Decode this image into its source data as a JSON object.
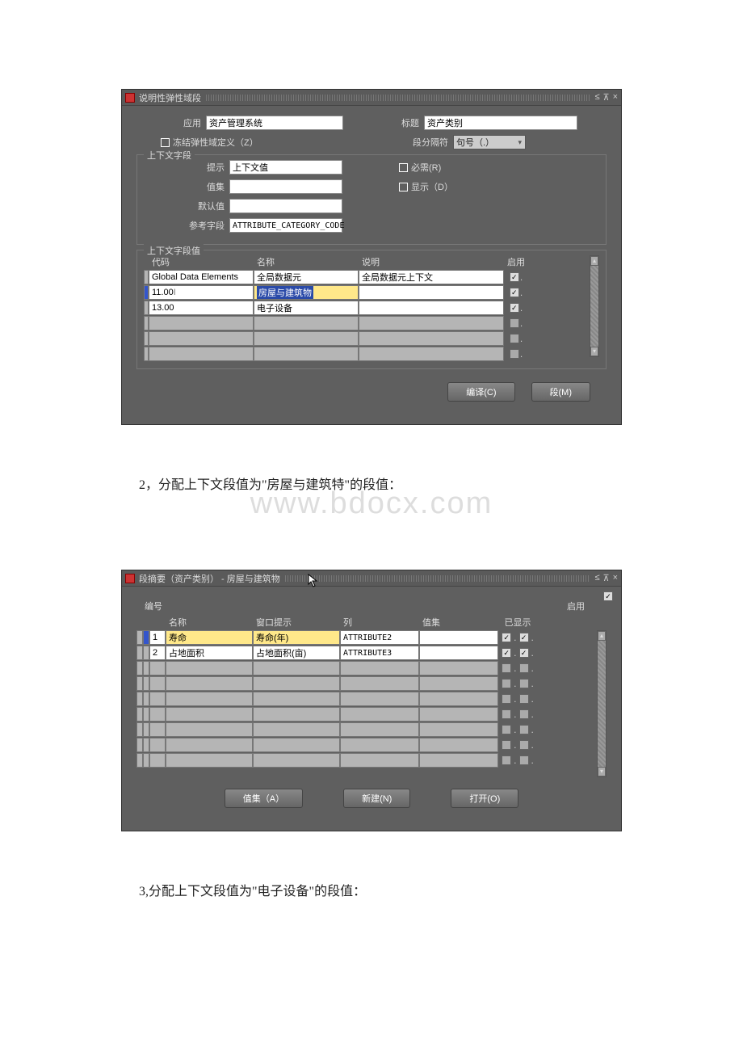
{
  "window1": {
    "title": "说明性弹性域段",
    "labels": {
      "application": "应用",
      "application_value": "资产管理系统",
      "freeze": "冻结弹性域定义（Z）",
      "title_lbl": "标题",
      "title_value": "资产类别",
      "separator": "段分隔符",
      "separator_value": "句号（.）",
      "context_fieldset": "上下文字段",
      "prompt": "提示",
      "prompt_value": "上下文值",
      "valueset": "值集",
      "valueset_value": "",
      "default": "默认值",
      "default_value": "",
      "reference": "参考字段",
      "reference_value": "ATTRIBUTE_CATEGORY_CODE",
      "required": "必需(R)",
      "display": "显示（D）",
      "context_values_fieldset": "上下文字段值",
      "cols": {
        "code": "代码",
        "name": "名称",
        "desc": "说明",
        "enabled": "启用"
      }
    },
    "rows": [
      {
        "code": "Global Data Elements",
        "name": "全局数据元",
        "desc": "全局数据元上下文",
        "enabled": true,
        "active": false,
        "hl": false
      },
      {
        "code": "11.00",
        "name": "房屋与建筑物",
        "desc": "",
        "enabled": true,
        "active": true,
        "hl": true
      },
      {
        "code": "13.00",
        "name": "电子设备",
        "desc": "",
        "enabled": true,
        "active": false,
        "hl": false
      }
    ],
    "buttons": {
      "compile": "编译(C)",
      "segment": "段(M)"
    }
  },
  "text1": "2，分配上下文段值为\"房屋与建筑特\"的段值：",
  "watermark": "www.bdocx.com",
  "window2": {
    "title": "段摘要（资产类别） - 房屋与建筑物",
    "labels": {
      "number": "编号",
      "enabled": "启用",
      "name": "名称",
      "winprompt": "窗口提示",
      "col": "列",
      "valueset": "值集",
      "displayed": "已显示"
    },
    "rows": [
      {
        "num": "1",
        "name": "寿命",
        "prompt": "寿命(年)",
        "col": "ATTRIBUTE2",
        "vs": "",
        "e1": true,
        "e2": true,
        "active": true
      },
      {
        "num": "2",
        "name": "占地面积",
        "prompt": "占地面积(亩)",
        "col": "ATTRIBUTE3",
        "vs": "",
        "e1": true,
        "e2": true,
        "active": false
      }
    ],
    "buttons": {
      "valueset": "值集（A）",
      "new": "新建(N)",
      "open": "打开(O)"
    }
  },
  "text2": "3,分配上下文段值为\"电子设备\"的段值："
}
